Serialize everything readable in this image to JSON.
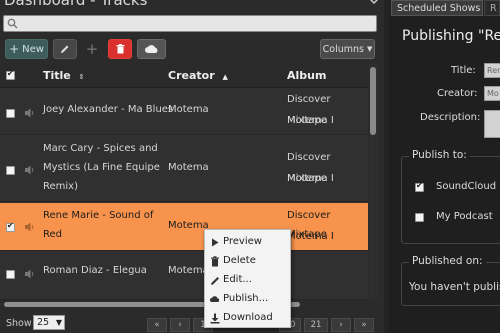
{
  "header": {
    "title": "Dashboard - Tracks"
  },
  "search": {
    "placeholder": ""
  },
  "toolbar": {
    "new_label": "New",
    "columns_label": "Columns"
  },
  "table": {
    "columns": [
      "Title",
      "Creator",
      "Album"
    ],
    "rows": [
      {
        "title_lines": [
          "Joey Alexander - Ma Blues"
        ],
        "creator": "Motema",
        "album_lines": [
          "Discover Motema I",
          "Mixtape"
        ],
        "checked": false,
        "selected": false
      },
      {
        "title_lines": [
          "Marc Cary - Spices and",
          "Mystics (La Fine Equipe",
          "Remix)"
        ],
        "creator": "Motema",
        "album_lines": [
          "Discover Motema I",
          "Mixtape"
        ],
        "checked": false,
        "selected": false
      },
      {
        "title_lines": [
          "Rene Marie - Sound of",
          "Red"
        ],
        "creator": "Motema",
        "album_lines": [
          "Discover Motema I",
          "Mixtape"
        ],
        "checked": true,
        "selected": true
      },
      {
        "title_lines": [
          "Roman Diaz - Elegua"
        ],
        "creator": "Motema",
        "album_lines": [],
        "checked": false,
        "selected": false
      }
    ]
  },
  "footer": {
    "show_label": "Show",
    "page_size": "25",
    "pager": [
      "«",
      "‹",
      "1",
      "20",
      "21",
      "›",
      "»"
    ]
  },
  "context_menu": {
    "items": [
      {
        "label": "Preview",
        "icon": "play-icon"
      },
      {
        "label": "Delete",
        "icon": "trash-icon"
      },
      {
        "label": "Edit...",
        "icon": "pencil-icon"
      },
      {
        "label": "Publish...",
        "icon": "cloud-icon"
      },
      {
        "label": "Download",
        "icon": "download-icon"
      }
    ]
  },
  "right_panel": {
    "tabs": [
      "Scheduled Shows",
      "R"
    ],
    "heading": "Publishing \"Ren",
    "title_label": "Title:",
    "title_value": "Ren",
    "creator_label": "Creator:",
    "creator_value": "Mo",
    "description_label": "Description:",
    "publish_to_legend": "Publish to:",
    "publish_targets": [
      {
        "label": "SoundCloud",
        "checked": true
      },
      {
        "label": "My Podcast",
        "checked": false
      }
    ],
    "published_on_legend": "Published on:",
    "published_on_text": "You haven't publish"
  }
}
